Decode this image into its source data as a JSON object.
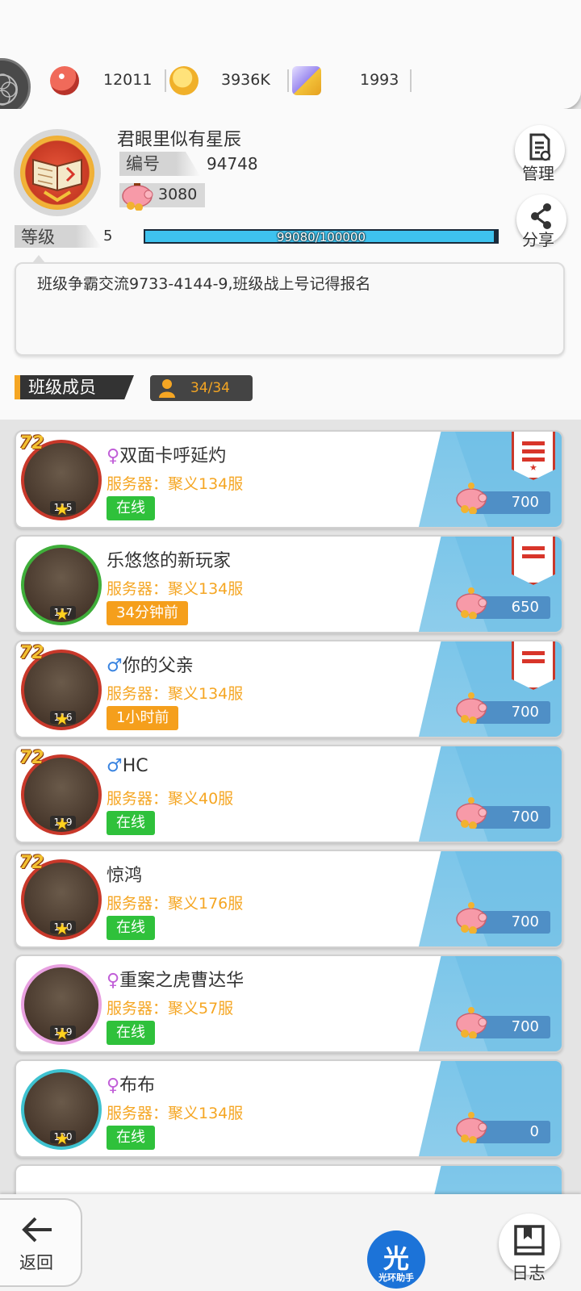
{
  "resources": [
    {
      "name": "red-gem",
      "value": "12011",
      "color": "#e85a4a"
    },
    {
      "name": "gold-coin",
      "value": "3936K",
      "color": "#f2b230"
    },
    {
      "name": "diamond-ring",
      "value": "1993",
      "color": "#a78bfa"
    }
  ],
  "class_info": {
    "name": "君眼里似有星辰",
    "id_label": "编号",
    "id_value": "94748",
    "funds": "3080",
    "level_label": "等级",
    "level_value": "5",
    "exp_text": "99080/100000",
    "exp_fraction": 0.9908,
    "manage_label": "管理",
    "share_label": "分享",
    "notice": "班级争霸交流9733-4144-9,班级战上号记得报名"
  },
  "members_section": {
    "title": "班级成员",
    "count": "34/34"
  },
  "members": [
    {
      "gender": "♀",
      "name": "双面卡呼延灼",
      "server": "服务器：聚义134服",
      "status": "在线",
      "online": true,
      "level": "115",
      "frame": "72",
      "contribution": "700",
      "rank": "leader"
    },
    {
      "gender": "",
      "name": "乐悠悠的新玩家",
      "server": "服务器：聚义134服",
      "status": "34分钟前",
      "online": false,
      "level": "117",
      "frame": "luck",
      "contribution": "650",
      "rank": "officer"
    },
    {
      "gender": "♂",
      "name": "你的父亲",
      "server": "服务器：聚义134服",
      "status": "1小时前",
      "online": false,
      "level": "116",
      "frame": "72",
      "contribution": "700",
      "rank": "officer"
    },
    {
      "gender": "♂",
      "name": "HC",
      "server": "服务器：聚义40服",
      "status": "在线",
      "online": true,
      "level": "119",
      "frame": "72",
      "contribution": "700",
      "rank": ""
    },
    {
      "gender": "",
      "name": "惊鸿",
      "server": "服务器：聚义176服",
      "status": "在线",
      "online": true,
      "level": "110",
      "frame": "72",
      "contribution": "700",
      "rank": ""
    },
    {
      "gender": "♀",
      "name": "重案之虎曹达华",
      "server": "服务器：聚义57服",
      "status": "在线",
      "online": true,
      "level": "119",
      "frame": "love",
      "contribution": "700",
      "rank": ""
    },
    {
      "gender": "♀",
      "name": "布布",
      "server": "服务器：聚义134服",
      "status": "在线",
      "online": true,
      "level": "120",
      "frame": "like",
      "contribution": "0",
      "rank": ""
    }
  ],
  "bottom": {
    "back_label": "返回",
    "helper_glyph": "光",
    "helper_label": "光环助手",
    "log_label": "日志"
  }
}
